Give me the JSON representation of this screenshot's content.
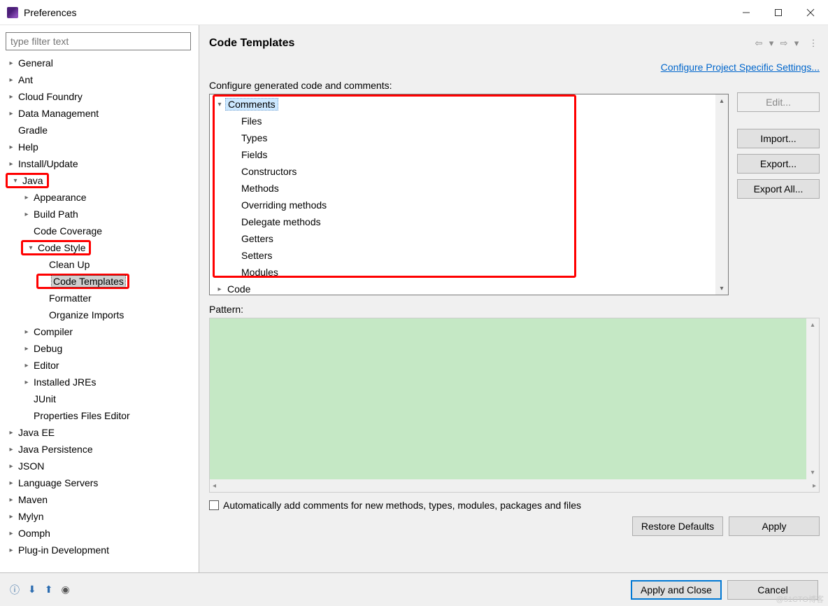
{
  "window": {
    "title": "Preferences"
  },
  "filter": {
    "placeholder": "type filter text"
  },
  "tree": {
    "items": [
      {
        "label": "General",
        "exp": ">"
      },
      {
        "label": "Ant",
        "exp": ">"
      },
      {
        "label": "Cloud Foundry",
        "exp": ">"
      },
      {
        "label": "Data Management",
        "exp": ">"
      },
      {
        "label": "Gradle",
        "exp": ""
      },
      {
        "label": "Help",
        "exp": ">"
      },
      {
        "label": "Install/Update",
        "exp": ">"
      },
      {
        "label": "Java",
        "exp": "v",
        "hl": true,
        "children": [
          {
            "label": "Appearance",
            "exp": ">"
          },
          {
            "label": "Build Path",
            "exp": ">"
          },
          {
            "label": "Code Coverage",
            "exp": ""
          },
          {
            "label": "Code Style",
            "exp": "v",
            "hl": true,
            "children": [
              {
                "label": "Clean Up",
                "exp": ""
              },
              {
                "label": "Code Templates",
                "exp": "",
                "selected": true,
                "hl": true
              },
              {
                "label": "Formatter",
                "exp": ""
              },
              {
                "label": "Organize Imports",
                "exp": ""
              }
            ]
          },
          {
            "label": "Compiler",
            "exp": ">"
          },
          {
            "label": "Debug",
            "exp": ">"
          },
          {
            "label": "Editor",
            "exp": ">"
          },
          {
            "label": "Installed JREs",
            "exp": ">"
          },
          {
            "label": "JUnit",
            "exp": ""
          },
          {
            "label": "Properties Files Editor",
            "exp": ""
          }
        ]
      },
      {
        "label": "Java EE",
        "exp": ">"
      },
      {
        "label": "Java Persistence",
        "exp": ">"
      },
      {
        "label": "JSON",
        "exp": ">"
      },
      {
        "label": "Language Servers",
        "exp": ">"
      },
      {
        "label": "Maven",
        "exp": ">"
      },
      {
        "label": "Mylyn",
        "exp": ">"
      },
      {
        "label": "Oomph",
        "exp": ">"
      },
      {
        "label": "Plug-in Development",
        "exp": ">"
      }
    ]
  },
  "page": {
    "title": "Code Templates",
    "config_link": "Configure Project Specific Settings...",
    "tree_label": "Configure generated code and comments:",
    "templates": {
      "comments_label": "Comments",
      "comments_children": [
        "Files",
        "Types",
        "Fields",
        "Constructors",
        "Methods",
        "Overriding methods",
        "Delegate methods",
        "Getters",
        "Setters",
        "Modules"
      ],
      "code_label": "Code"
    },
    "buttons": {
      "edit": "Edit...",
      "import": "Import...",
      "export": "Export...",
      "export_all": "Export All..."
    },
    "pattern_label": "Pattern:",
    "auto_label": "Automatically add comments for new methods, types, modules, packages and files",
    "restore": "Restore Defaults",
    "apply": "Apply"
  },
  "footer": {
    "apply_close": "Apply and Close",
    "cancel": "Cancel"
  },
  "watermark": "@51CTO博客"
}
